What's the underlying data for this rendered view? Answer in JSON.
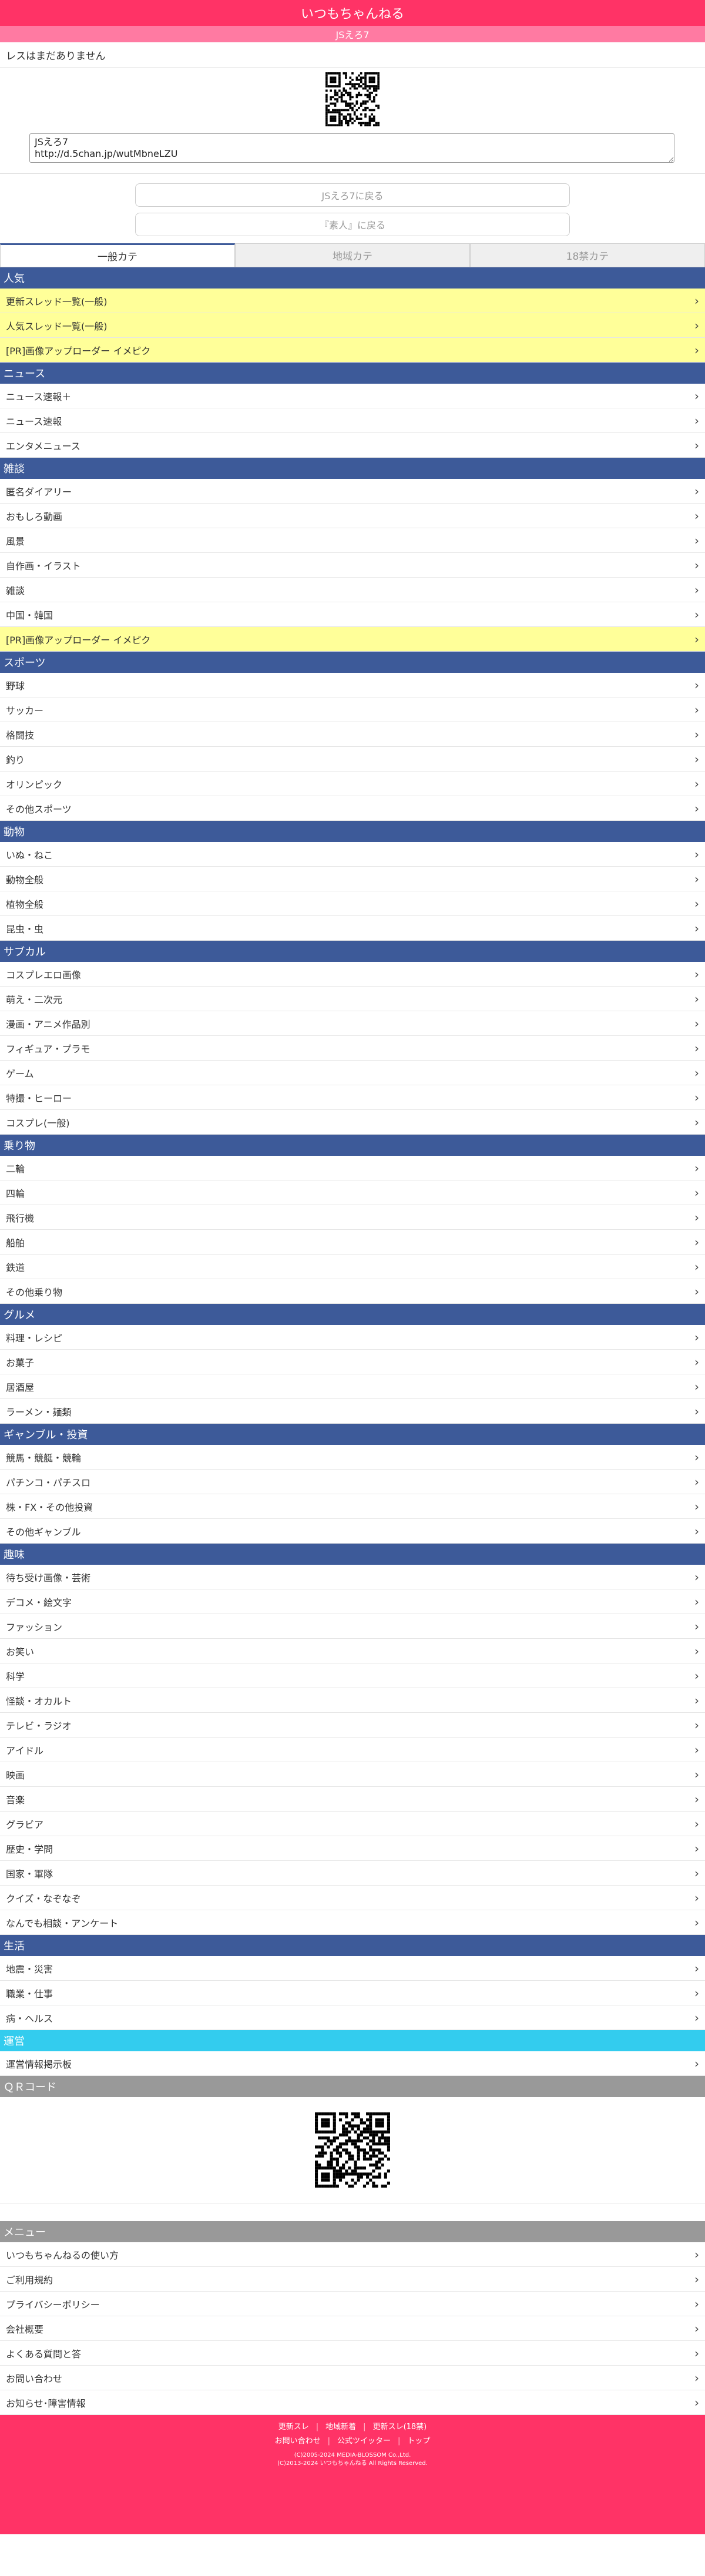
{
  "header": {
    "title": "いつもちゃんねる",
    "subtitle": "JSえろ7"
  },
  "thread": {
    "no_res": "レスはまだありません",
    "share_text": "JSえろ7\nhttp://d.5chan.jp/wutMbneLZU",
    "back_thread": "JSえろ7に戻る",
    "back_board": "『素人』に戻る"
  },
  "tabs": [
    "一般カテ",
    "地域カテ",
    "18禁カテ"
  ],
  "categories": [
    {
      "name": "人気",
      "items": [
        {
          "label": "更新スレッド一覧(一般)",
          "hl": true
        },
        {
          "label": "人気スレッド一覧(一般)",
          "hl": true
        },
        {
          "label": "[PR]画像アップローダー イメピク",
          "hl": true
        }
      ]
    },
    {
      "name": "ニュース",
      "items": [
        {
          "label": "ニュース速報＋"
        },
        {
          "label": "ニュース速報"
        },
        {
          "label": "エンタメニュース"
        }
      ]
    },
    {
      "name": "雑談",
      "items": [
        {
          "label": "匿名ダイアリー"
        },
        {
          "label": "おもしろ動画"
        },
        {
          "label": "風景"
        },
        {
          "label": "自作画・イラスト"
        },
        {
          "label": "雑談"
        },
        {
          "label": "中国・韓国"
        },
        {
          "label": "[PR]画像アップローダー イメピク",
          "hl": true
        }
      ]
    },
    {
      "name": "スポーツ",
      "items": [
        {
          "label": "野球"
        },
        {
          "label": "サッカー"
        },
        {
          "label": "格闘技"
        },
        {
          "label": "釣り"
        },
        {
          "label": "オリンピック"
        },
        {
          "label": "その他スポーツ"
        }
      ]
    },
    {
      "name": "動物",
      "items": [
        {
          "label": "いぬ・ねこ"
        },
        {
          "label": "動物全般"
        },
        {
          "label": "植物全般"
        },
        {
          "label": "昆虫・虫"
        }
      ]
    },
    {
      "name": "サブカル",
      "items": [
        {
          "label": "コスプレエロ画像"
        },
        {
          "label": "萌え・二次元"
        },
        {
          "label": "漫画・アニメ作品別"
        },
        {
          "label": "フィギュア・プラモ"
        },
        {
          "label": "ゲーム"
        },
        {
          "label": "特撮・ヒーロー"
        },
        {
          "label": "コスプレ(一般)"
        }
      ]
    },
    {
      "name": "乗り物",
      "items": [
        {
          "label": "二輪"
        },
        {
          "label": "四輪"
        },
        {
          "label": "飛行機"
        },
        {
          "label": "船舶"
        },
        {
          "label": "鉄道"
        },
        {
          "label": "その他乗り物"
        }
      ]
    },
    {
      "name": "グルメ",
      "items": [
        {
          "label": "料理・レシピ"
        },
        {
          "label": "お菓子"
        },
        {
          "label": "居酒屋"
        },
        {
          "label": "ラーメン・麺類"
        }
      ]
    },
    {
      "name": "ギャンブル・投資",
      "items": [
        {
          "label": "競馬・競艇・競輪"
        },
        {
          "label": "パチンコ・パチスロ"
        },
        {
          "label": "株・FX・その他投資"
        },
        {
          "label": "その他ギャンブル"
        }
      ]
    },
    {
      "name": "趣味",
      "items": [
        {
          "label": "待ち受け画像・芸術"
        },
        {
          "label": "デコメ・絵文字"
        },
        {
          "label": "ファッション"
        },
        {
          "label": "お笑い"
        },
        {
          "label": "科学"
        },
        {
          "label": "怪談・オカルト"
        },
        {
          "label": "テレビ・ラジオ"
        },
        {
          "label": "アイドル"
        },
        {
          "label": "映画"
        },
        {
          "label": "音楽"
        },
        {
          "label": "グラビア"
        },
        {
          "label": "歴史・学問"
        },
        {
          "label": "国家・軍隊"
        },
        {
          "label": "クイズ・なぞなぞ"
        },
        {
          "label": "なんでも相談・アンケート"
        }
      ]
    },
    {
      "name": "生活",
      "items": [
        {
          "label": "地震・災害"
        },
        {
          "label": "職業・仕事"
        },
        {
          "label": "病・ヘルス"
        }
      ]
    },
    {
      "name": "運営",
      "style": "run",
      "items": [
        {
          "label": "運営情報掲示板"
        }
      ]
    }
  ],
  "qr_section": {
    "title": "ＱＲコード"
  },
  "menu": {
    "title": "メニュー",
    "items": [
      "いつもちゃんねるの使い方",
      "ご利用規約",
      "プライバシーポリシー",
      "会社概要",
      "よくある質問と答",
      "お問い合わせ",
      "お知らせ･障害情報"
    ]
  },
  "footer": {
    "links_row1": [
      "更新スレ",
      "地域新着",
      "更新スレ(18禁)"
    ],
    "links_row2": [
      "お問い合わせ",
      "公式ツイッター",
      "トップ"
    ],
    "copy1": "(C)2005-2024 MEDIA-BLOSSOM Co.,Ltd.",
    "copy2": "(C)2013-2024 いつもちゃんねる All Rights Reserved."
  },
  "colors": {
    "header": "#ff3366",
    "subheader": "#ff7aa2",
    "category": "#3d5a99",
    "highlight": "#ffff99",
    "run": "#33ccee",
    "gray": "#999999"
  }
}
